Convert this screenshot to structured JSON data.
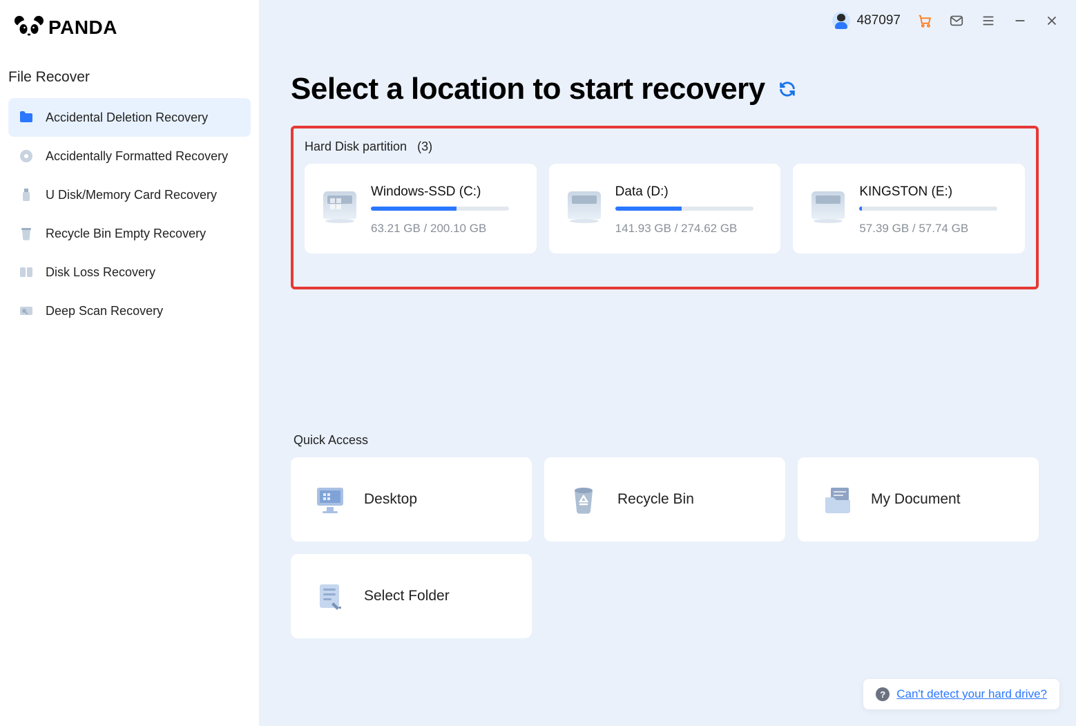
{
  "brand": {
    "name": "PANDA"
  },
  "sidebar": {
    "heading": "File Recover",
    "items": [
      {
        "label": "Accidental Deletion Recovery",
        "active": true
      },
      {
        "label": "Accidentally Formatted Recovery",
        "active": false
      },
      {
        "label": "U Disk/Memory Card Recovery",
        "active": false
      },
      {
        "label": "Recycle Bin Empty Recovery",
        "active": false
      },
      {
        "label": "Disk Loss Recovery",
        "active": false
      },
      {
        "label": "Deep Scan Recovery",
        "active": false
      }
    ]
  },
  "header": {
    "user_id": "487097"
  },
  "main": {
    "title": "Select a location to start recovery",
    "partitions": {
      "label_prefix": "Hard Disk partition",
      "count_suffix": "(3)",
      "items": [
        {
          "name": "Windows-SSD   (C:)",
          "used": "63.21 GB",
          "total": "200.10 GB",
          "percent": 62,
          "windows": true
        },
        {
          "name": "Data   (D:)",
          "used": "141.93 GB",
          "total": "274.62 GB",
          "percent": 48,
          "windows": false
        },
        {
          "name": "KINGSTON   (E:)",
          "used": "57.39 GB",
          "total": "57.74 GB",
          "percent": 2,
          "windows": false
        }
      ]
    },
    "quick": {
      "label": "Quick Access",
      "items": [
        {
          "label": "Desktop"
        },
        {
          "label": "Recycle Bin"
        },
        {
          "label": "My Document"
        },
        {
          "label": "Select Folder"
        }
      ]
    },
    "help_link": "Can't detect your hard drive?"
  }
}
